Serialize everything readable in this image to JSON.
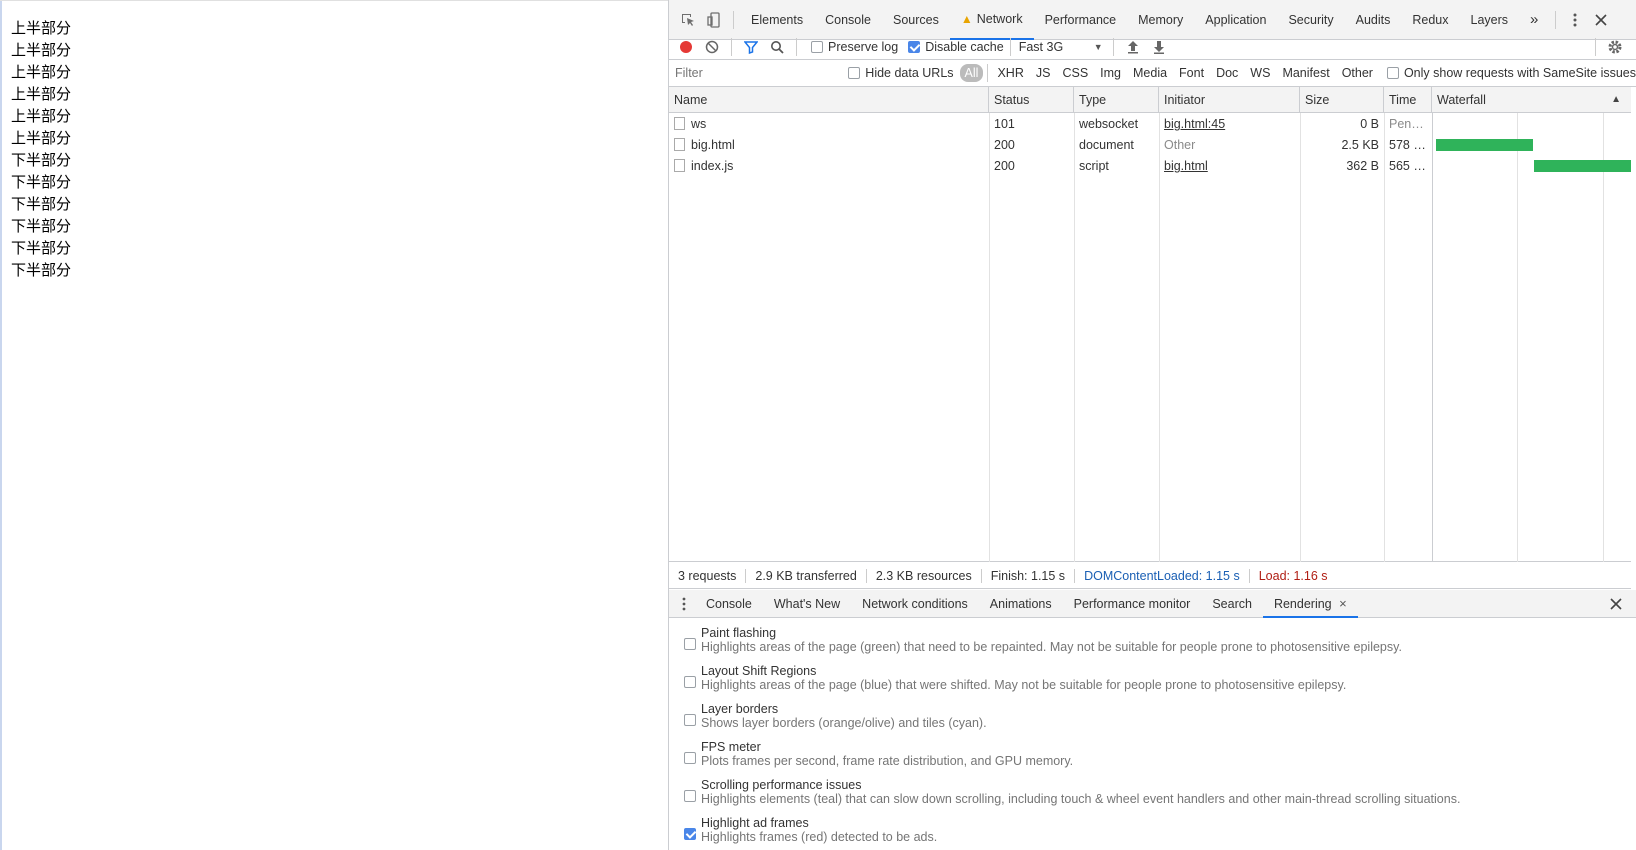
{
  "page": {
    "lines": [
      "上半部分",
      "上半部分",
      "上半部分",
      "上半部分",
      "上半部分",
      "上半部分",
      "下半部分",
      "下半部分",
      "下半部分",
      "下半部分",
      "下半部分",
      "下半部分"
    ]
  },
  "devtools": {
    "tabs": [
      "Elements",
      "Console",
      "Sources",
      "Network",
      "Performance",
      "Memory",
      "Application",
      "Security",
      "Audits",
      "Redux",
      "Layers"
    ],
    "active_tab": "Network",
    "more_tabs": "»",
    "toolbar": {
      "preserve_log": "Preserve log",
      "disable_cache": "Disable cache",
      "throttle": "Fast 3G"
    },
    "filter": {
      "placeholder": "Filter",
      "hide_data_urls": "Hide data URLs",
      "types": [
        "All",
        "XHR",
        "JS",
        "CSS",
        "Img",
        "Media",
        "Font",
        "Doc",
        "WS",
        "Manifest",
        "Other"
      ],
      "samesite": "Only show requests with SameSite issues"
    },
    "table": {
      "columns": [
        "Name",
        "Status",
        "Type",
        "Initiator",
        "Size",
        "Time",
        "Waterfall"
      ],
      "sort_indicator": "▲",
      "rows": [
        {
          "name": "ws",
          "status": "101",
          "type": "websocket",
          "initiator": "big.html:45",
          "size": "0 B",
          "time": "Pen…"
        },
        {
          "name": "big.html",
          "status": "200",
          "type": "document",
          "initiator": "Other",
          "size": "2.5 KB",
          "time": "578 …"
        },
        {
          "name": "index.js",
          "status": "200",
          "type": "script",
          "initiator": "big.html",
          "size": "362 B",
          "time": "565 …"
        }
      ]
    },
    "status": {
      "requests": "3 requests",
      "transferred": "2.9 KB transferred",
      "resources": "2.3 KB resources",
      "finish": "Finish: 1.15 s",
      "dcl": "DOMContentLoaded: 1.15 s",
      "load": "Load: 1.16 s"
    },
    "drawer": {
      "tabs": [
        "Console",
        "What's New",
        "Network conditions",
        "Animations",
        "Performance monitor",
        "Search",
        "Rendering"
      ],
      "active": "Rendering",
      "close_tab": "×"
    },
    "rendering": [
      {
        "title": "Paint flashing",
        "desc": "Highlights areas of the page (green) that need to be repainted. May not be suitable for people prone to photosensitive epilepsy.",
        "checked": false
      },
      {
        "title": "Layout Shift Regions",
        "desc": "Highlights areas of the page (blue) that were shifted. May not be suitable for people prone to photosensitive epilepsy.",
        "checked": false
      },
      {
        "title": "Layer borders",
        "desc": "Shows layer borders (orange/olive) and tiles (cyan).",
        "checked": false
      },
      {
        "title": "FPS meter",
        "desc": "Plots frames per second, frame rate distribution, and GPU memory.",
        "checked": false
      },
      {
        "title": "Scrolling performance issues",
        "desc": "Highlights elements (teal) that can slow down scrolling, including touch & wheel event handlers and other main-thread scrolling situations.",
        "checked": false
      },
      {
        "title": "Highlight ad frames",
        "desc": "Highlights frames (red) detected to be ads.",
        "checked": true
      }
    ],
    "colors": {
      "accent": "#1a73e8",
      "waterfall": "#2fb35a",
      "dcl": "#1a5fb4",
      "load": "#b01e14",
      "record": "#e53935"
    }
  }
}
